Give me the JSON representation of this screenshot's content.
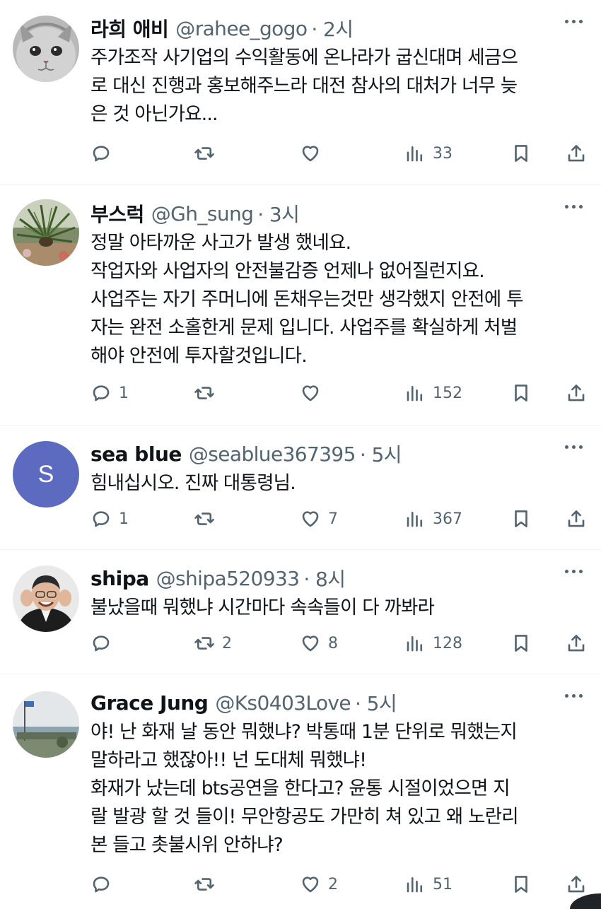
{
  "tweets": [
    {
      "name": "라희 애비",
      "handle": "@rahee_gogo",
      "time": "· 2시",
      "text": "주가조작 사기업의 수익활동에 온나라가 굽신대며 세금으\n로 대신  진행과 홍보해주느라 대전 참사의 대처가 너무 늦\n은 것 아닌가요...",
      "replies": "",
      "retweets": "",
      "likes": "",
      "views": "33",
      "avatar": "cat-avatar"
    },
    {
      "name": "부스럭",
      "handle": "@Gh_sung",
      "time": "· 3시",
      "text": "정말 아타까운 사고가 발생 했네요.\n작업자와 사업자의 안전불감증 언제나 없어질런지요.\n사업주는 자기 주머니에 돈채우는것만 생각했지 안전에 투\n자는 완전 소홀한게 문제 입니다. 사업주를 확실하게 처벌\n해야 안전에 투자할것입니다.",
      "replies": "1",
      "retweets": "",
      "likes": "",
      "views": "152",
      "avatar": "palm-plant-avatar"
    },
    {
      "name": "sea blue",
      "handle": "@seablue367395",
      "time": "· 5시",
      "text": "힘내십시오. 진짜 대통령님.",
      "replies": "1",
      "retweets": "",
      "likes": "7",
      "views": "367",
      "avatar": "letter-avatar",
      "avatar_letter": "S",
      "avatar_color": "#5c6bc0"
    },
    {
      "name": "shipa",
      "handle": "@shipa520933",
      "time": "· 8시",
      "text": "불났을때 뭐했냐 시간마다 속속들이 다 까봐라",
      "replies": "",
      "retweets": "2",
      "likes": "8",
      "views": "128",
      "avatar": "person-avatar"
    },
    {
      "name": "Grace Jung",
      "handle": "@Ks0403Love",
      "time": "· 5시",
      "text": "야! 난 화재 날 동안 뭐했냐? 박통때 1분 단위로 뭐했는지\n말하라고 했잖아!! 넌 도대체 뭐했냐!\n화재가 났는데 bts공연을 한다고? 윤통 시절이었으면 지\n랄 발광 할 것 들이! 무안항공도 가만히 쳐 있고 왜 노란리\n본 들고 촛불시위 안하냐?",
      "replies": "",
      "retweets": "",
      "likes": "2",
      "views": "51",
      "avatar": "seaside-flag-avatar"
    }
  ],
  "colors": {
    "text": "#0f1419",
    "secondary": "#536471",
    "divider": "#eff3f4"
  }
}
